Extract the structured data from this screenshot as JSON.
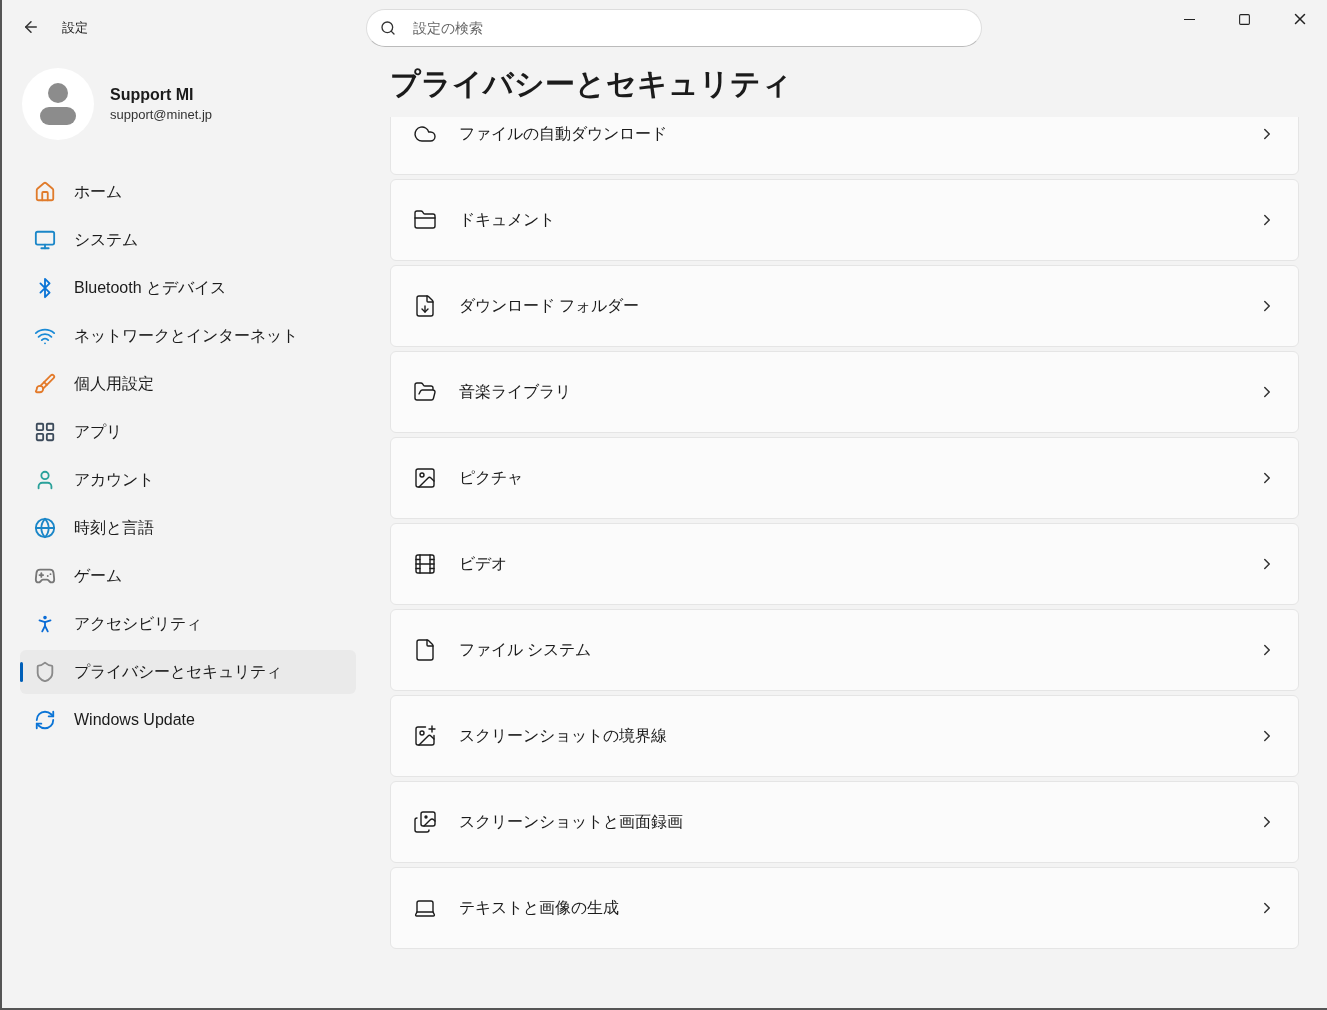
{
  "window": {
    "title": "設定"
  },
  "search": {
    "placeholder": "設定の検索"
  },
  "user": {
    "name": "Support MI",
    "email": "support@minet.jp"
  },
  "sidebar": {
    "items": [
      {
        "label": "ホーム",
        "selected": false
      },
      {
        "label": "システム",
        "selected": false
      },
      {
        "label": "Bluetooth とデバイス",
        "selected": false
      },
      {
        "label": "ネットワークとインターネット",
        "selected": false
      },
      {
        "label": "個人用設定",
        "selected": false
      },
      {
        "label": "アプリ",
        "selected": false
      },
      {
        "label": "アカウント",
        "selected": false
      },
      {
        "label": "時刻と言語",
        "selected": false
      },
      {
        "label": "ゲーム",
        "selected": false
      },
      {
        "label": "アクセシビリティ",
        "selected": false
      },
      {
        "label": "プライバシーとセキュリティ",
        "selected": true
      },
      {
        "label": "Windows Update",
        "selected": false
      }
    ]
  },
  "page": {
    "title": "プライバシーとセキュリティ",
    "items": [
      {
        "label": "ファイルの自動ダウンロード"
      },
      {
        "label": "ドキュメント"
      },
      {
        "label": "ダウンロード フォルダー"
      },
      {
        "label": "音楽ライブラリ"
      },
      {
        "label": "ピクチャ"
      },
      {
        "label": "ビデオ"
      },
      {
        "label": "ファイル システム"
      },
      {
        "label": "スクリーンショットの境界線"
      },
      {
        "label": "スクリーンショットと画面録画"
      },
      {
        "label": "テキストと画像の生成"
      }
    ]
  }
}
